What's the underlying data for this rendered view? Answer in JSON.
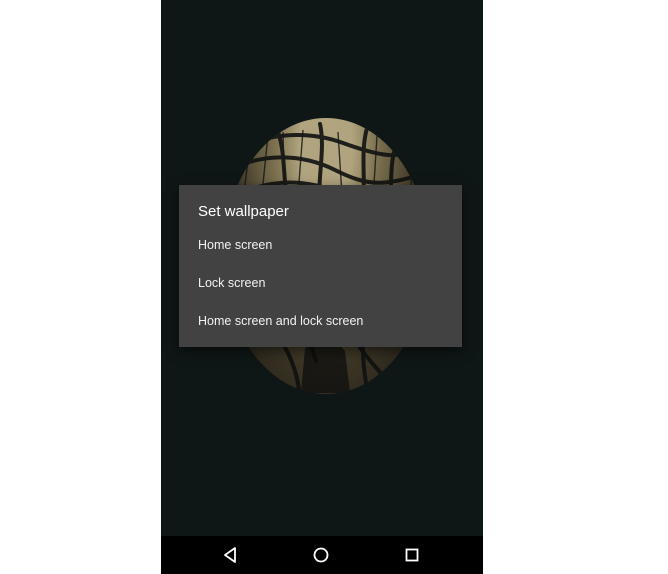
{
  "dialog": {
    "title": "Set wallpaper",
    "options": [
      {
        "label": "Home screen"
      },
      {
        "label": "Lock screen"
      },
      {
        "label": "Home screen and lock screen"
      }
    ]
  },
  "navbar": {
    "back_icon": "back-triangle-icon",
    "home_icon": "home-circle-icon",
    "recent_icon": "recent-apps-square-icon"
  },
  "colors": {
    "screen_background": "#0f1716",
    "dialog_background": "#424242",
    "navigation_background": "#000000",
    "text": "#ffffff"
  }
}
